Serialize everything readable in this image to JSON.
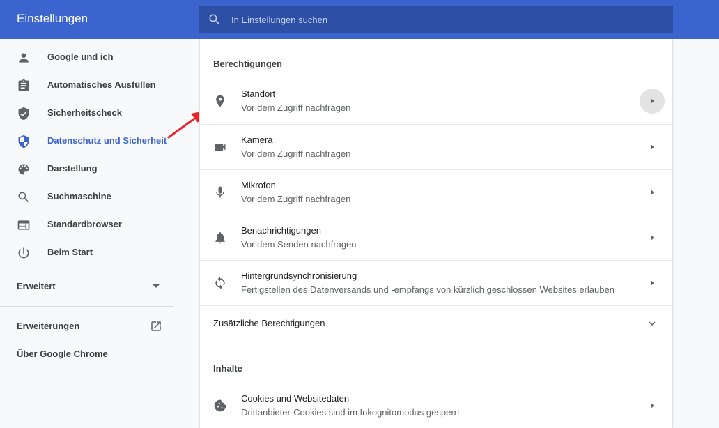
{
  "header": {
    "title": "Einstellungen",
    "search_placeholder": "In Einstellungen suchen"
  },
  "sidebar": {
    "items": [
      {
        "label": "Google und ich",
        "icon": "person-icon"
      },
      {
        "label": "Automatisches Ausfüllen",
        "icon": "clipboard-icon"
      },
      {
        "label": "Sicherheitscheck",
        "icon": "shield-check-icon"
      },
      {
        "label": "Datenschutz und Sicherheit",
        "icon": "shield-icon",
        "active": true
      },
      {
        "label": "Darstellung",
        "icon": "palette-icon"
      },
      {
        "label": "Suchmaschine",
        "icon": "search-icon"
      },
      {
        "label": "Standardbrowser",
        "icon": "browser-icon"
      },
      {
        "label": "Beim Start",
        "icon": "power-icon"
      }
    ],
    "advanced_label": "Erweitert",
    "extensions_label": "Erweiterungen",
    "about_label": "Über Google Chrome"
  },
  "main": {
    "permissions_heading": "Berechtigungen",
    "permissions": [
      {
        "name": "Standort",
        "description": "Vor dem Zugriff nachfragen",
        "icon": "location-pin-icon"
      },
      {
        "name": "Kamera",
        "description": "Vor dem Zugriff nachfragen",
        "icon": "camera-icon"
      },
      {
        "name": "Mikrofon",
        "description": "Vor dem Zugriff nachfragen",
        "icon": "microphone-icon"
      },
      {
        "name": "Benachrichtigungen",
        "description": "Vor dem Senden nachfragen",
        "icon": "bell-icon"
      },
      {
        "name": "Hintergrundsynchronisierung",
        "description": "Fertigstellen des Datenversands und -empfangs von kürzlich geschlossen Websites erlauben",
        "icon": "sync-icon"
      }
    ],
    "additional_permissions_label": "Zusätzliche Berechtigungen",
    "content_heading": "Inhalte",
    "content_items": [
      {
        "name": "Cookies und Websitedaten",
        "description": "Drittanbieter-Cookies sind im Inkognitomodus gesperrt",
        "icon": "cookie-icon"
      }
    ]
  },
  "colors": {
    "header_bg": "#3c64cf",
    "search_bg": "#2e4fa6",
    "active_nav": "#3c64cf",
    "annotation_arrow": "#e8232a"
  }
}
